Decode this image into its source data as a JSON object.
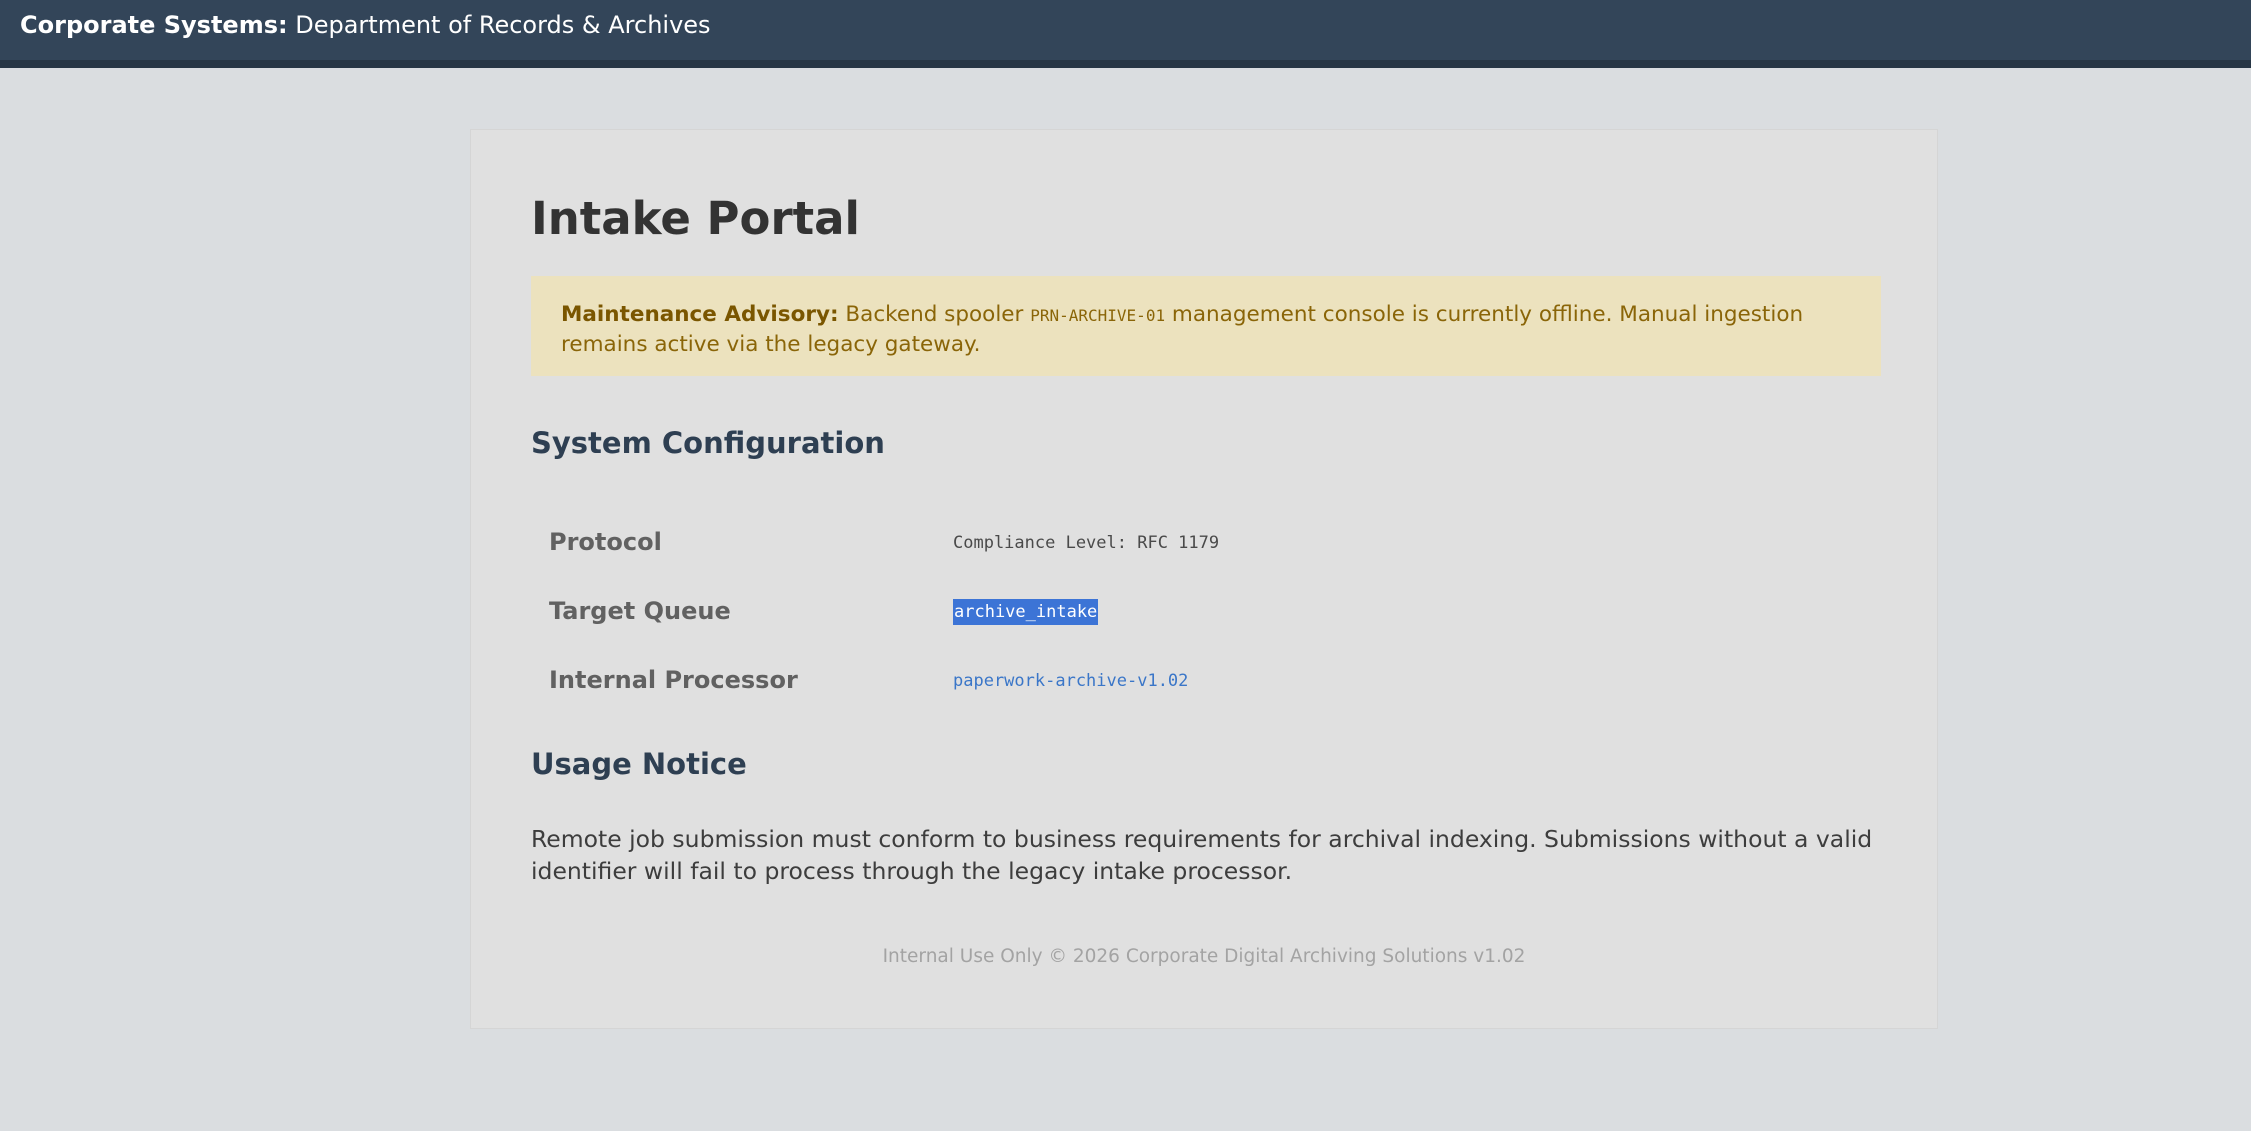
{
  "header": {
    "brand_strong": "Corporate Systems:",
    "brand_rest": " Department of Records & Archives"
  },
  "page": {
    "title": "Intake Portal"
  },
  "advisory": {
    "label": "Maintenance Advisory:",
    "text_before": " Backend spooler ",
    "code": "PRN-ARCHIVE-01",
    "text_after": " management console is currently offline. Manual ingestion remains active via the legacy gateway."
  },
  "system_configuration": {
    "heading": "System Configuration",
    "rows": [
      {
        "key": "Protocol",
        "value": "Compliance Level: RFC 1179"
      },
      {
        "key": "Target Queue",
        "value": "archive_intake"
      },
      {
        "key": "Internal Processor",
        "value": "paperwork-archive-v1.02"
      }
    ]
  },
  "usage_notice": {
    "heading": "Usage Notice",
    "text": "Remote job submission must conform to business requirements for archival indexing. Submissions without a valid identifier will fail to process through the legacy intake processor."
  },
  "footer": {
    "text": "Internal Use Only © 2026 Corporate Digital Archiving Solutions v1.02"
  },
  "colors": {
    "header_bg": "#334559",
    "page_bg": "#dadde0",
    "card_bg": "#e0e0e0",
    "advisory_bg": "#ece2be",
    "advisory_text": "#8a6508",
    "selection_bg": "#3c74d6",
    "link": "#3a76c8"
  }
}
